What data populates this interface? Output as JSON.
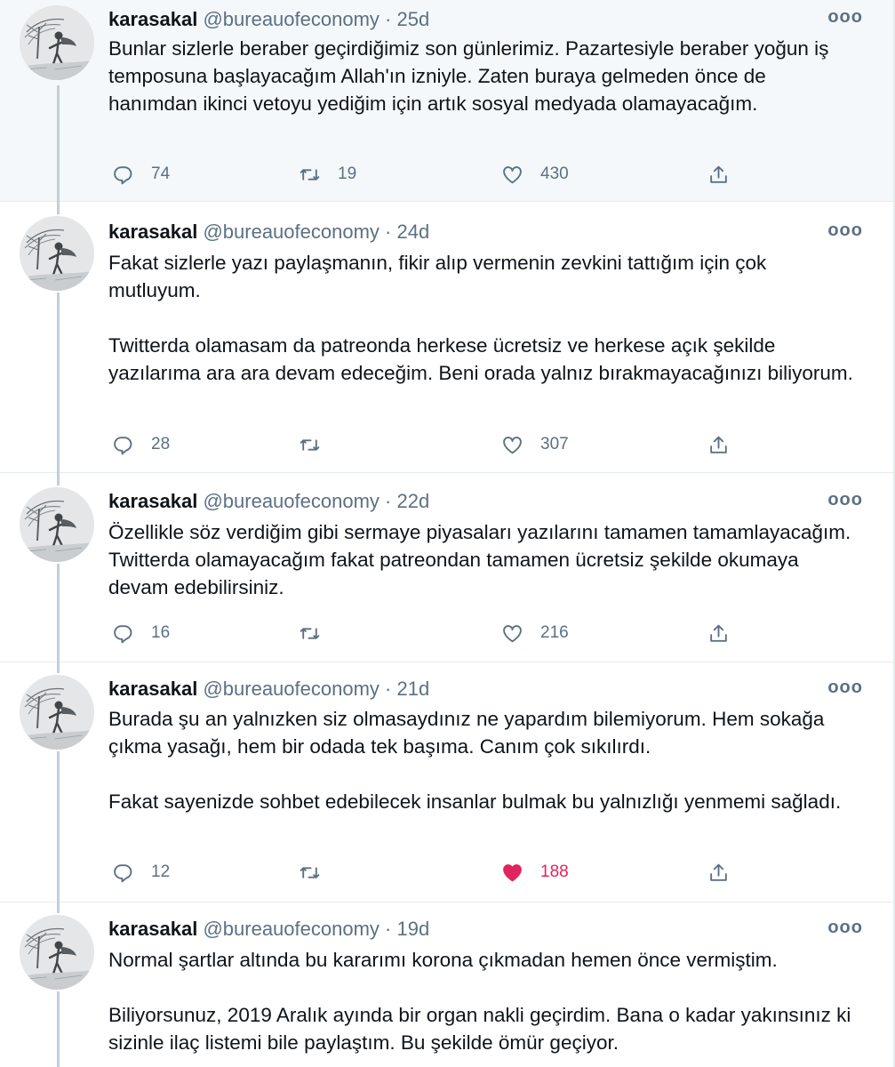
{
  "tweets": [
    {
      "name": "karasakal",
      "handle": "@bureauofeconomy",
      "sep": "·",
      "time": "25d",
      "more": "ooo",
      "paragraphs": [
        "Bunlar sizlerle beraber geçirdiğimiz son günlerimiz. Pazartesiyle beraber yoğun iş temposuna başlayacağım Allah'ın izniyle. Zaten buraya gelmeden önce de hanımdan ikinci vetoyu yediğim için artık sosyal medyada olamayacağım."
      ],
      "replies": "74",
      "retweets": "19",
      "likes": "430",
      "liked": false
    },
    {
      "name": "karasakal",
      "handle": "@bureauofeconomy",
      "sep": "·",
      "time": "24d",
      "more": "ooo",
      "paragraphs": [
        "Fakat sizlerle yazı paylaşmanın, fikir alıp vermenin zevkini tattığım için çok mutluyum.",
        "Twitterda olamasam da patreonda herkese ücretsiz ve herkese açık şekilde yazılarıma ara ara devam edeceğim. Beni orada yalnız bırakmayacağınızı biliyorum."
      ],
      "replies": "28",
      "retweets": "",
      "likes": "307",
      "liked": false
    },
    {
      "name": "karasakal",
      "handle": "@bureauofeconomy",
      "sep": "·",
      "time": "22d",
      "more": "ooo",
      "paragraphs": [
        "Özellikle söz verdiğim gibi sermaye piyasaları yazılarını tamamen tamamlayacağım. Twitterda olamayacağım fakat patreondan tamamen ücretsiz şekilde okumaya devam edebilirsiniz."
      ],
      "replies": "16",
      "retweets": "",
      "likes": "216",
      "liked": false
    },
    {
      "name": "karasakal",
      "handle": "@bureauofeconomy",
      "sep": "·",
      "time": "21d",
      "more": "ooo",
      "paragraphs": [
        "Burada şu an yalnızken siz olmasaydınız ne yapardım bilemiyorum. Hem sokağa çıkma yasağı, hem bir odada tek başıma. Canım çok sıkılırdı.",
        "Fakat sayenizde sohbet edebilecek insanlar bulmak bu yalnızlığı yenmemi sağladı."
      ],
      "replies": "12",
      "retweets": "",
      "likes": "188",
      "liked": true
    },
    {
      "name": "karasakal",
      "handle": "@bureauofeconomy",
      "sep": "·",
      "time": "19d",
      "more": "ooo",
      "paragraphs": [
        "Normal şartlar altında bu kararımı korona çıkmadan hemen önce vermiştim.",
        "Biliyorsunuz, 2019 Aralık ayında bir organ nakli geçirdim. Bana o kadar yakınsınız ki sizinle ilaç listemi bile paylaştım. Bu şekilde ömür geçiyor."
      ]
    }
  ],
  "colors": {
    "text": "#0f1419",
    "secondary": "#5b7083",
    "like": "#e0245e",
    "thread_line": "#c4cfd6",
    "highlight_bg": "#f5f8fa"
  },
  "icons": {
    "reply": "speech-bubble-icon",
    "retweet": "retweet-arrows-icon",
    "like": "heart-icon",
    "share": "share-upload-icon",
    "more": "more-dots-icon"
  }
}
